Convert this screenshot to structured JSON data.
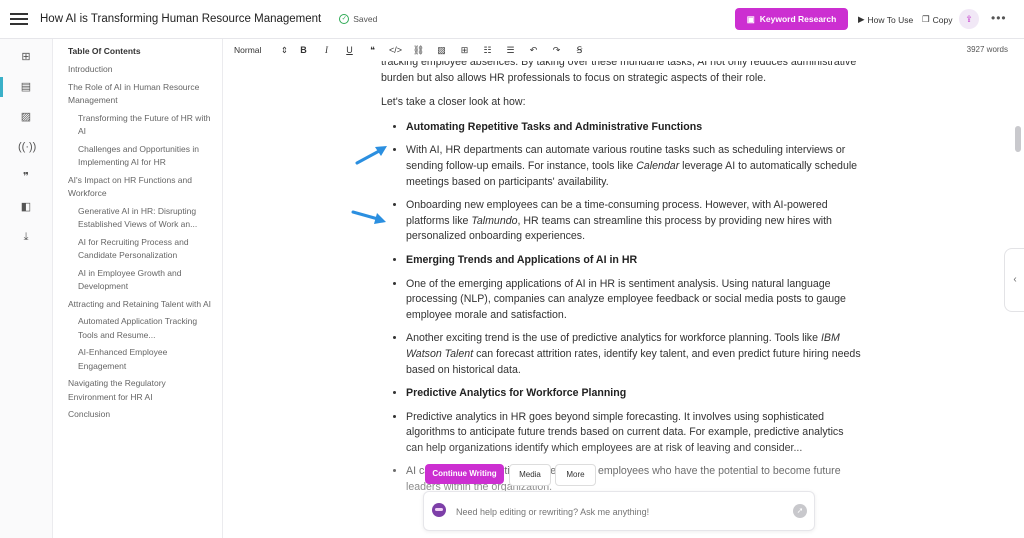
{
  "header": {
    "title": "How AI is Transforming Human Resource Management",
    "saved_label": "Saved",
    "keyword_research_label": "Keyword Research",
    "how_to_use_label": "How To Use",
    "copy_label": "Copy"
  },
  "toc": {
    "heading": "Table Of Contents",
    "items": [
      {
        "label": "Introduction",
        "sub": false
      },
      {
        "label": "The Role of AI in Human Resource Management",
        "sub": false
      },
      {
        "label": "Transforming the Future of HR with AI",
        "sub": true
      },
      {
        "label": "Challenges and Opportunities in Implementing AI for HR",
        "sub": true
      },
      {
        "label": "AI's Impact on HR Functions and Workforce",
        "sub": false
      },
      {
        "label": "Generative AI in HR: Disrupting Established Views of Work an...",
        "sub": true
      },
      {
        "label": "AI for Recruiting Process and Candidate Personalization",
        "sub": true
      },
      {
        "label": "AI in Employee Growth and Development",
        "sub": true
      },
      {
        "label": "Attracting and Retaining Talent with AI",
        "sub": false
      },
      {
        "label": "Automated Application Tracking Tools and Resume...",
        "sub": true
      },
      {
        "label": "AI-Enhanced Employee Engagement",
        "sub": true
      },
      {
        "label": "Navigating the Regulatory Environment for HR AI",
        "sub": false
      },
      {
        "label": "Conclusion",
        "sub": false
      }
    ]
  },
  "toolbar": {
    "style_value": "Normal",
    "word_count": "3927 words"
  },
  "content": {
    "intro_para": "tracking employee absences. By taking over these mundane tasks, AI not only reduces administrative burden but also allows HR professionals to focus on strategic aspects of their role.",
    "lead_in": "Let's take a closer look at how:",
    "b1": "Automating Repetitive Tasks and Administrative Functions",
    "b2_pre": "With AI, HR departments can automate various routine tasks such as scheduling interviews or sending follow-up emails. For instance, tools like ",
    "b2_em": "Calendar",
    "b2_post": " leverage AI to automatically schedule meetings based on participants' availability.",
    "b3_pre": "Onboarding new employees can be a time-consuming process. However, with AI-powered platforms like ",
    "b3_em": "Talmundo",
    "b3_post": ", HR teams can streamline this process by providing new hires with personalized onboarding experiences.",
    "b4": "Emerging Trends and Applications of AI in HR",
    "b5": "One of the emerging applications of AI in HR is sentiment analysis. Using natural language processing (NLP), companies can analyze employee feedback or social media posts to gauge employee morale and satisfaction.",
    "b6_pre": "Another exciting trend is the use of predictive analytics for workforce planning. Tools like ",
    "b6_em": "IBM Watson Talent",
    "b6_post": " can forecast attrition rates, identify key talent, and even predict future hiring needs based on historical data.",
    "b7": "Predictive Analytics for Workforce Planning",
    "b8": "Predictive analytics in HR goes beyond simple forecasting. It involves using sophisticated algorithms to anticipate future trends based on current data. For example, predictive analytics can help organizations identify which employees are at risk of leaving and consider...",
    "b9": "AI can also help identify high-performing employees who have the potential to become future leaders within the organization."
  },
  "assistant": {
    "continue_label": "Continue Writing",
    "media_label": "Media",
    "more_label": "More",
    "ask_placeholder": "Need help editing or rewriting? Ask me anything!"
  }
}
